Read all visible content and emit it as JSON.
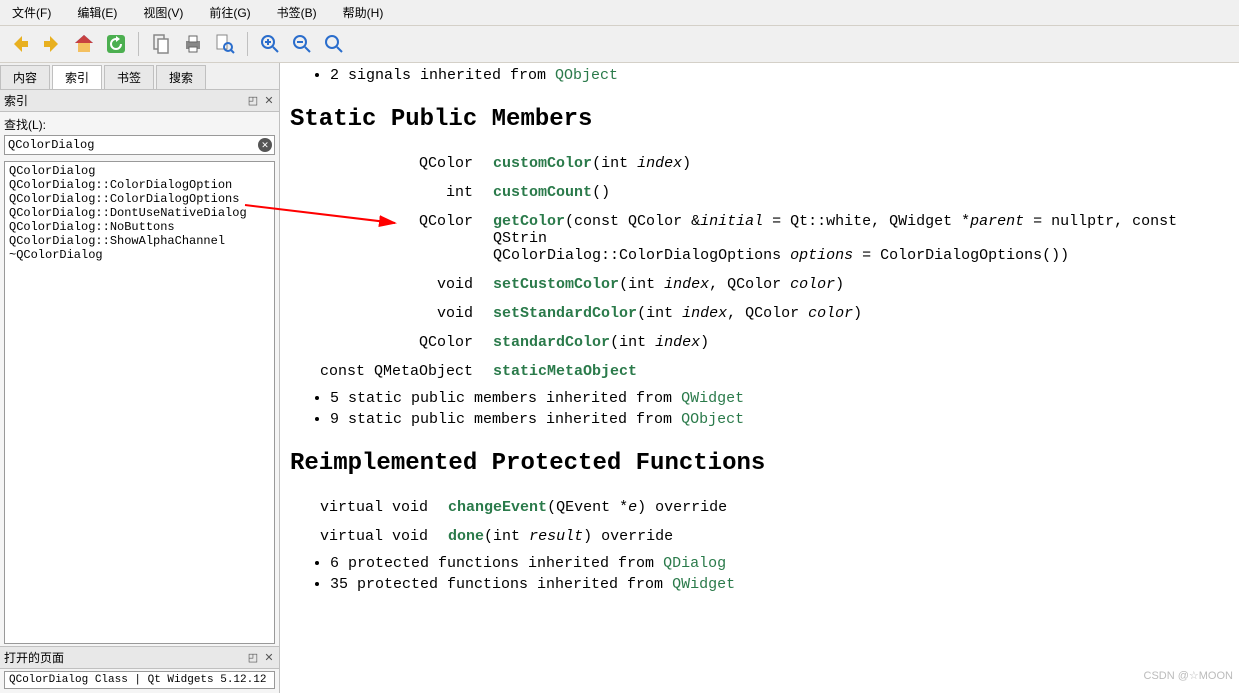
{
  "menu": {
    "file": "文件(F)",
    "edit": "编辑(E)",
    "view": "视图(V)",
    "goto": "前往(G)",
    "bookmark": "书签(B)",
    "help": "帮助(H)"
  },
  "sideTabs": {
    "contents": "内容",
    "index": "索引",
    "bookmark": "书签",
    "search": "搜索"
  },
  "indexPanel": {
    "title": "索引",
    "searchLabel": "查找(L):",
    "searchValue": "QColorDialog",
    "items": [
      "QColorDialog",
      "QColorDialog::ColorDialogOption",
      "QColorDialog::ColorDialogOptions",
      "QColorDialog::DontUseNativeDialog",
      "QColorDialog::NoButtons",
      "QColorDialog::ShowAlphaChannel",
      "~QColorDialog"
    ]
  },
  "openPages": {
    "title": "打开的页面",
    "item": "QColorDialog Class | Qt Widgets 5.12.12"
  },
  "doc": {
    "inheritedTop": [
      {
        "prefix": "2 signals inherited from ",
        "link": "QObject"
      }
    ],
    "staticHeading": "Static Public Members",
    "staticMembers": [
      {
        "ret": "QColor",
        "name": "customColor",
        "sig1": "(int ",
        "p1": "index",
        "sig2": ")"
      },
      {
        "ret": "int",
        "name": "customCount",
        "sig1": "()",
        "p1": "",
        "sig2": ""
      },
      {
        "ret": "QColor",
        "name": "getColor",
        "sigFull": "(const QColor &<i>initial</i> = Qt::white, QWidget *<i>parent</i> = nullptr, const QStrin\nQColorDialog::ColorDialogOptions <i>options</i> = ColorDialogOptions())"
      },
      {
        "ret": "void",
        "name": "setCustomColor",
        "sigFull": "(int <i>index</i>, QColor <i>color</i>)"
      },
      {
        "ret": "void",
        "name": "setStandardColor",
        "sigFull": "(int <i>index</i>, QColor <i>color</i>)"
      },
      {
        "ret": "QColor",
        "name": "standardColor",
        "sigFull": "(int <i>index</i>)"
      },
      {
        "ret": "const QMetaObject",
        "name": "staticMetaObject",
        "sigFull": ""
      }
    ],
    "staticInherited": [
      {
        "prefix": "5 static public members inherited from ",
        "link": "QWidget"
      },
      {
        "prefix": "9 static public members inherited from ",
        "link": "QObject"
      }
    ],
    "reimplHeading": "Reimplemented Protected Functions",
    "reimplMembers": [
      {
        "ret": "virtual void",
        "name": "changeEvent",
        "sigFull": "(QEvent *<i>e</i>) override"
      },
      {
        "ret": "virtual void",
        "name": "done",
        "sigFull": "(int <i>result</i>) override"
      }
    ],
    "reimplInherited": [
      {
        "prefix": "6 protected functions inherited from ",
        "link": "QDialog"
      },
      {
        "prefix": "35 protected functions inherited from ",
        "link": "QWidget"
      }
    ]
  },
  "watermark": "CSDN @☆MOON"
}
